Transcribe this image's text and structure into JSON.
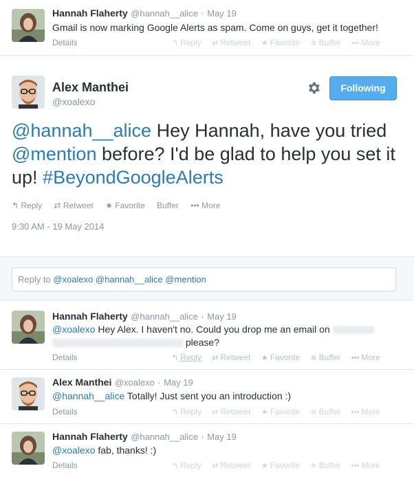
{
  "tweet_top": {
    "name": "Hannah Flaherty",
    "handle": "@hannah__alice",
    "date": "May 19",
    "text": "Gmail is now marking Google Alerts as spam. Come on guys, get it together!",
    "details": "Details",
    "actions": {
      "reply": "Reply",
      "retweet": "Retweet",
      "favorite": "Favorite",
      "buffer": "Buffer",
      "more": "More"
    }
  },
  "main_tweet": {
    "name": "Alex Manthei",
    "handle": "@xoalexo",
    "follow_label": "Following",
    "text_mention": "@hannah__alice",
    "text_a": " Hey Hannah, have you tried ",
    "text_mention2": "@mention",
    "text_b": " before? I'd be glad to help you set it up! ",
    "text_hashtag": "#BeyondGoogleAlerts",
    "actions": {
      "reply": "Reply",
      "retweet": "Retweet",
      "favorite": "Favorite",
      "buffer": "Buffer",
      "more": "More"
    },
    "timestamp": "9:30 AM - 19 May 2014"
  },
  "reply_box": {
    "prefix": "Reply to ",
    "mentions": "@xoalexo @hannah__alice @mention"
  },
  "replies": [
    {
      "name": "Hannah Flaherty",
      "handle": "@hannah__alice",
      "date": "May 19",
      "mention": "@xoalexo",
      "text": " Hey Alex. I haven't no. Could you drop me an email on",
      "text2": "please?",
      "details": "Details"
    },
    {
      "name": "Alex Manthei",
      "handle": "@xoalexo",
      "date": "May 19",
      "mention": "@hannah__alice",
      "text": " Totally! Just sent you an introduction :)",
      "details": "Details"
    },
    {
      "name": "Hannah Flaherty",
      "handle": "@hannah__alice",
      "date": "May 19",
      "mention": "@xoalexo",
      "text": " fab, thanks! :)",
      "details": "Details"
    }
  ],
  "action_labels": {
    "reply": "Reply",
    "retweet": "Retweet",
    "favorite": "Favorite",
    "buffer": "Buffer",
    "more": "More"
  },
  "icons": {
    "reply": "reply-icon",
    "retweet": "retweet-icon",
    "favorite": "star-icon",
    "buffer": "buffer-icon",
    "more": "more-icon",
    "settings": "gear-icon"
  },
  "colors": {
    "link": "#2b7bb9",
    "follow_button": "#55acee",
    "muted": "#8899a6",
    "reply_area_bg": "#f5f8fa"
  }
}
